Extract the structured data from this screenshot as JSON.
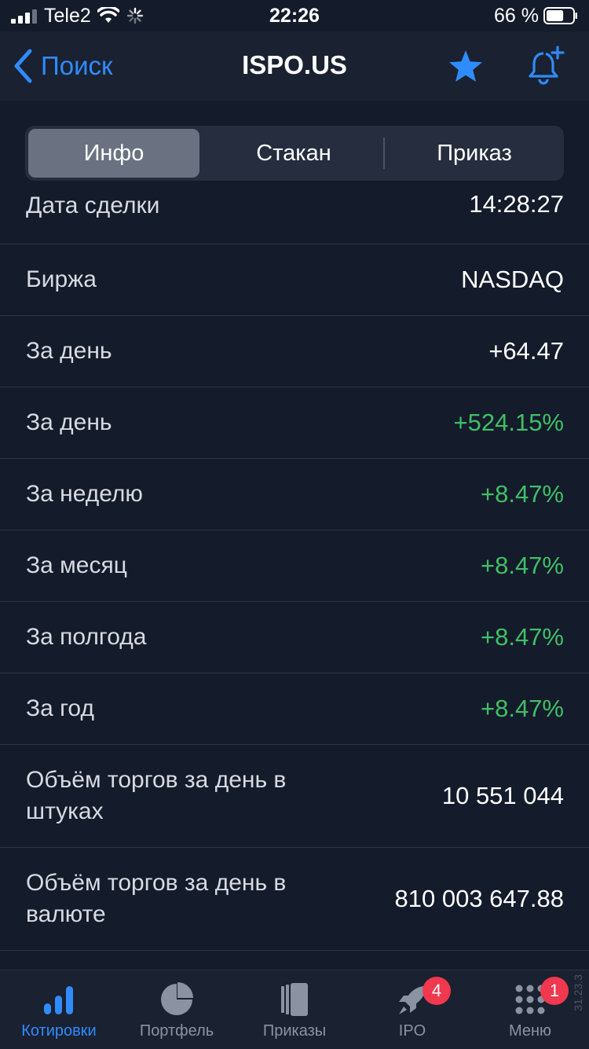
{
  "status_bar": {
    "carrier": "Tele2",
    "time": "22:26",
    "battery_percent": "66 %",
    "battery_level": 0.66
  },
  "nav": {
    "back_label": "Поиск",
    "title": "ISPO.US"
  },
  "tabs": [
    {
      "label": "Инфо",
      "selected": true
    },
    {
      "label": "Стакан",
      "selected": false
    },
    {
      "label": "Приказ",
      "selected": false
    }
  ],
  "rows": [
    {
      "label": "Дата сделки",
      "value": "14:28:27"
    },
    {
      "label": "Биржа",
      "value": "NASDAQ"
    },
    {
      "label": "За день",
      "value": "+64.47"
    },
    {
      "label": "За день",
      "value": "+524.15%",
      "positive": true
    },
    {
      "label": "За неделю",
      "value": "+8.47%",
      "positive": true
    },
    {
      "label": "За месяц",
      "value": "+8.47%",
      "positive": true
    },
    {
      "label": "За полгода",
      "value": "+8.47%",
      "positive": true
    },
    {
      "label": "За год",
      "value": "+8.47%",
      "positive": true
    },
    {
      "label": "Объём торгов за день в штуках",
      "value": "10 551 044"
    },
    {
      "label": "Объём торгов за день в валюте",
      "value": "810 003 647.88"
    }
  ],
  "tab_bar": [
    {
      "label": "Котировки",
      "icon": "bar-chart-icon",
      "active": true
    },
    {
      "label": "Портфель",
      "icon": "pie-chart-icon",
      "active": false
    },
    {
      "label": "Приказы",
      "icon": "orders-icon",
      "active": false
    },
    {
      "label": "IPO",
      "icon": "rocket-icon",
      "active": false,
      "badge": "4"
    },
    {
      "label": "Меню",
      "icon": "menu-grid-icon",
      "active": false,
      "badge": "1"
    }
  ],
  "version": "31.23.3",
  "colors": {
    "background": "#141b2b",
    "bar": "#1a2131",
    "accent": "#2f8cff",
    "positive": "#3fc065",
    "badge": "#f0384e"
  }
}
